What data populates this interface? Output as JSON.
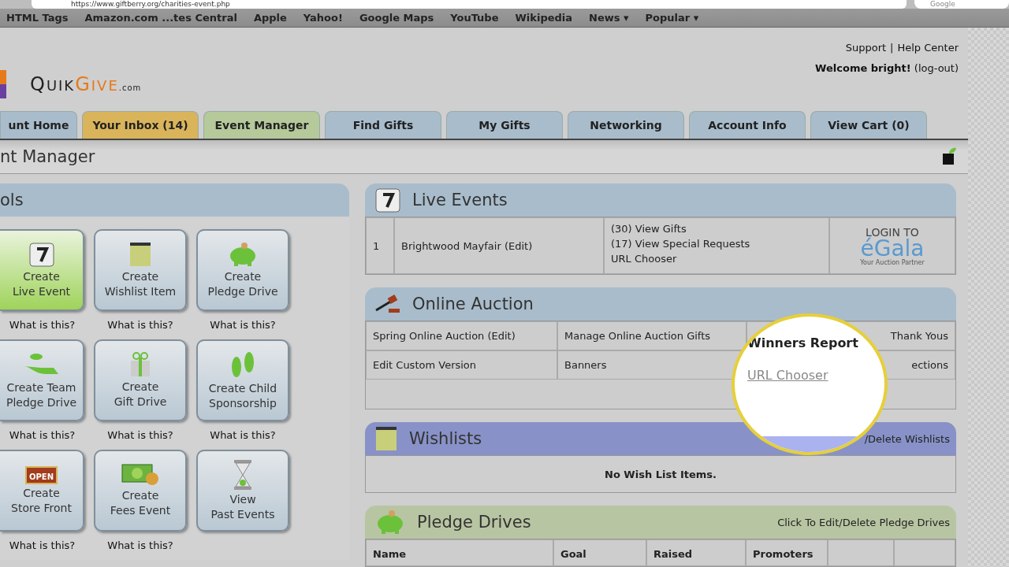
{
  "browser": {
    "url": "https://www.giftberry.org/charities-event.php",
    "search_placeholder": "Google",
    "bookmarks": [
      {
        "label": "HTML Tags",
        "menu": false
      },
      {
        "label": "Amazon.com ...tes Central",
        "menu": false
      },
      {
        "label": "Apple",
        "menu": false
      },
      {
        "label": "Yahoo!",
        "menu": false
      },
      {
        "label": "Google Maps",
        "menu": false
      },
      {
        "label": "YouTube",
        "menu": false
      },
      {
        "label": "Wikipedia",
        "menu": false
      },
      {
        "label": "News",
        "menu": true,
        "arrow": "▾"
      },
      {
        "label": "Popular",
        "menu": true,
        "arrow": "▾"
      }
    ]
  },
  "logo": {
    "dark": "QUIK",
    "accent": "GIVE",
    "suffix": ".com"
  },
  "top_links": [
    "Support",
    "Help Center"
  ],
  "top_links_separator": "|",
  "welcome": "**Welcome bright!** (log-out)",
  "tabs": [
    {
      "label": "unt Home",
      "color": "#a9bccb"
    },
    {
      "label": "Your Inbox (14)",
      "color": "#d9b45a"
    },
    {
      "label": "Event Manager",
      "color": "#b5c99a"
    },
    {
      "label": "Find Gifts",
      "color": "#a9bccb"
    },
    {
      "label": "My Gifts",
      "color": "#a9bccb"
    },
    {
      "label": "Networking",
      "color": "#a9bccb"
    },
    {
      "label": "Account Info",
      "color": "#a9bccb"
    },
    {
      "label": "View Cart (0)",
      "color": "#a9bccb"
    }
  ],
  "page_title": "nt Manager",
  "tools": {
    "title": "ols",
    "items": [
      {
        "kind": "calendar",
        "label": "Create\nLive Event",
        "help": "What is this?",
        "selected": true
      },
      {
        "kind": "notepad",
        "label": "Create\nWishlist Item",
        "help": "What is this?",
        "selected": false
      },
      {
        "kind": "piggy",
        "label": "Create\nPledge Drive",
        "help": "What is this?",
        "selected": false
      },
      {
        "kind": "hand",
        "label": "Create Team\nPledge Drive",
        "help": "What is this?",
        "selected": false
      },
      {
        "kind": "gift",
        "label": "Create\nGift Drive",
        "help": "What is this?",
        "selected": false
      },
      {
        "kind": "feet",
        "label": "Create Child\nSponsorship",
        "help": "What is this?",
        "selected": false
      },
      {
        "kind": "open",
        "label": "Create\nStore Front",
        "help": "What is this?",
        "selected": false,
        "sign": "OPEN"
      },
      {
        "kind": "money",
        "label": "Create\nFees Event",
        "help": "What is this?",
        "selected": false
      },
      {
        "kind": "hourglass",
        "label": "View\nPast Events",
        "selected": false
      }
    ]
  },
  "live_events": {
    "title": "Live Events",
    "rows": [
      {
        "number": "1",
        "name": "Brightwood Mayfair (Edit)",
        "links": [
          "(30) View Gifts",
          "(17) View Special Requests",
          "URL Chooser"
        ],
        "badge": {
          "line1": "LOGIN TO",
          "brand": "éGala",
          "tagline": "Your Auction Partner"
        }
      }
    ]
  },
  "online_auction": {
    "title": "Online Auction",
    "rows": [
      [
        "Spring Online Auction (Edit)",
        "Manage Online Auction Gifts",
        "Thank Yous"
      ],
      [
        "Edit Custom Version",
        "Banners",
        "ections"
      ]
    ]
  },
  "magnifier": {
    "heading": "Winners Report",
    "link": "URL Chooser"
  },
  "wishlists": {
    "title": "Wishlists",
    "action": "/Delete Wishlists",
    "empty": "No Wish List Items."
  },
  "pledge_drives": {
    "title": "Pledge Drives",
    "action": "Click To Edit/Delete Pledge Drives",
    "columns": [
      "Name",
      "Goal",
      "Raised",
      "Promoters"
    ]
  }
}
